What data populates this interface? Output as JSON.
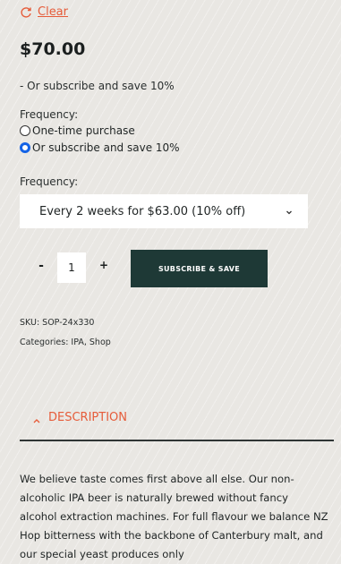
{
  "clear": {
    "label": "Clear",
    "icon": "refresh-icon"
  },
  "price": "$70.00",
  "subscribe_note": "- Or subscribe and save 10%",
  "frequency_label_1": "Frequency:",
  "purchase_options": [
    {
      "label": "One-time purchase",
      "selected": false
    },
    {
      "label": "Or subscribe and save 10%",
      "selected": true
    }
  ],
  "frequency_label_2": "Frequency:",
  "frequency_select": {
    "value": "Every 2 weeks for $63.00 (10% off)",
    "icon": "chevron-down-icon"
  },
  "quantity": {
    "minus": "-",
    "value": "1",
    "plus": "+"
  },
  "subscribe_button": "SUBSCRIBE & SAVE",
  "sku": "SKU: SOP-24x330",
  "categories": "Categories: IPA, Shop",
  "description": {
    "label": "DESCRIPTION",
    "icon": "chevron-up-icon"
  },
  "description_text": "We believe taste comes first above all else. Our non-alcoholic IPA beer is naturally brewed without fancy alcohol extraction machines. For full flavour we balance NZ Hop bitterness with the backbone of Canterbury malt, and our special yeast produces only",
  "colors": {
    "accent": "#e65c3a",
    "button": "#1e3936",
    "radio_selected": "#1463e6"
  }
}
